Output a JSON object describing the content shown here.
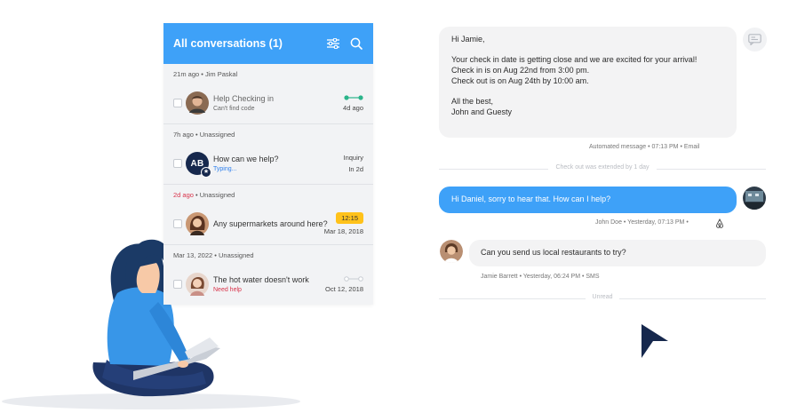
{
  "list": {
    "title": "All conversations (1)",
    "filter_icon": "sliders-icon",
    "search_icon": "search-icon",
    "conversations": [
      {
        "meta": "21m ago • Jim Paskal",
        "subject": "Help Checking in",
        "sub": "Can't find code",
        "right_top": "",
        "right_bottom": "4d ago"
      },
      {
        "meta": "7h ago • Unassigned",
        "initials": "AB",
        "subject": "How can we help?",
        "sub": "Typing...",
        "right_top": "Inquiry",
        "right_bottom": "In 2d"
      },
      {
        "meta_red": "2d ago",
        "meta_rest": " • Unassigned",
        "subject": "Any supermarkets around here?",
        "sub": "",
        "right_top": "12:15",
        "right_bottom": "Mar 18, 2018"
      },
      {
        "meta": "Mar 13, 2022 • Unassigned",
        "subject": "The hot water doesn't work",
        "sub": "Need help",
        "right_top": "",
        "right_bottom": "Oct 12, 2018"
      }
    ]
  },
  "chat": {
    "message1": {
      "greeting": "Hi Jamie,",
      "line1": "Your check in date is getting close and we are excited for your arrival!",
      "line2": "Check in is on Aug 22nd from 3:00 pm.",
      "line3": "Check out is on Aug 24th by 10:00 am.",
      "signoff1": "All the best,",
      "signoff2": "John and Guesty",
      "meta": "Automated message • 07:13 PM • Email"
    },
    "divider1": "Check out was extended by 1 day",
    "message2": {
      "text": "Hi Daniel, sorry to hear that. How can I help?",
      "meta": "John Doe • Yesterday, 07:13 PM •"
    },
    "message3": {
      "text": "Can you send us local restaurants to try?",
      "meta": "Jamie Barrett • Yesterday, 06:24 PM • SMS"
    },
    "divider2": "Unread"
  },
  "colors": {
    "accent": "#3ea1f8",
    "alert_red": "#d8334a",
    "badge_yellow": "#ffc21a",
    "status_green": "#2bb48a",
    "navy": "#16284d"
  }
}
